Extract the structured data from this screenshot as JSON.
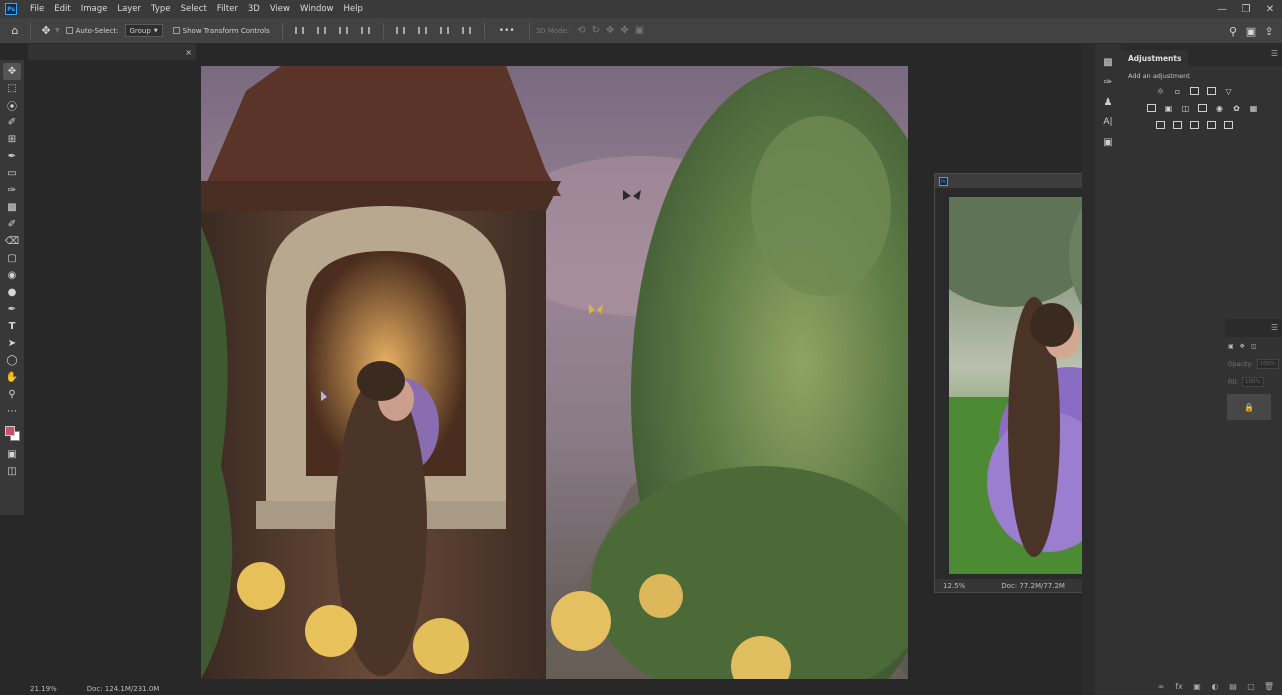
{
  "menu": {
    "logo": "Ps",
    "items": [
      "File",
      "Edit",
      "Image",
      "Layer",
      "Type",
      "Select",
      "Filter",
      "3D",
      "View",
      "Window",
      "Help"
    ],
    "window_controls": [
      "minimize",
      "restore",
      "close"
    ]
  },
  "options_bar": {
    "auto_select_label": "Auto-Select:",
    "auto_select_value": "Group",
    "show_transform_label": "Show Transform Controls",
    "mode_3d_label": "3D Mode:",
    "more_label": "•••"
  },
  "toolbar": {
    "tools": [
      "move-tool",
      "marquee-tool",
      "lasso-tool",
      "quick-select-tool",
      "crop-tool",
      "eyedropper-tool",
      "healing-tool",
      "brush-tool",
      "clone-stamp-tool",
      "history-brush-tool",
      "eraser-tool",
      "gradient-tool",
      "blur-tool",
      "dodge-tool",
      "pen-tool",
      "type-tool",
      "path-select-tool",
      "shape-tool",
      "hand-tool",
      "zoom-tool",
      "edit-toolbar"
    ],
    "foreground_color": "#c8506a",
    "background_color": "#ffffff"
  },
  "document": {
    "tab_close": "×",
    "zoom": "21.19%",
    "doc_size": "Doc: 124.1M/231.0M"
  },
  "floating_window": {
    "zoom": "12.5%",
    "doc_size": "Doc: 77.2M/77.2M",
    "arrow": "›"
  },
  "adjustments": {
    "tab_label": "Adjustments",
    "hint": "Add an adjustment",
    "row1": [
      "brightness-icon",
      "levels-icon",
      "curves-icon",
      "exposure-icon",
      "gradient-triangle-icon"
    ],
    "row2": [
      "vibrance-icon",
      "hue-sat-icon",
      "color-balance-icon",
      "bw-icon",
      "photo-filter-icon",
      "channel-mixer-icon",
      "color-lookup-icon"
    ],
    "row3": [
      "invert-icon",
      "posterize-icon",
      "threshold-icon",
      "selective-color-icon",
      "gradient-map-icon"
    ]
  },
  "layers_panel": {
    "opacity_label": "Opacity:",
    "opacity_value": "100%",
    "fill_label": "Fill:",
    "fill_value": "100%"
  }
}
